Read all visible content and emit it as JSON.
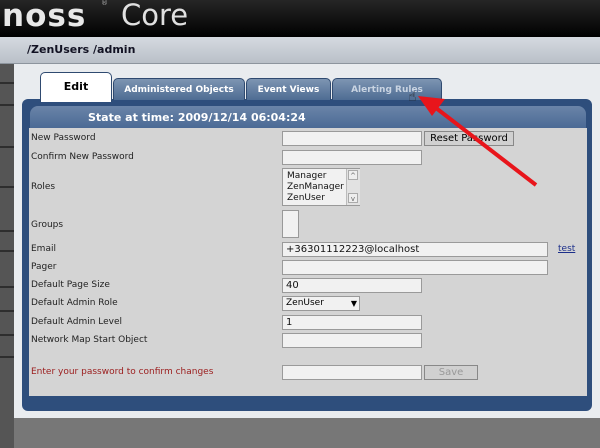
{
  "app": {
    "logo_left": "noss",
    "logo_tm": "®",
    "logo_right": "Core"
  },
  "breadcrumb": "/ZenUsers /admin",
  "tabs": [
    {
      "label": "Edit",
      "active": true
    },
    {
      "label": "Administered Objects",
      "active": false
    },
    {
      "label": "Event Views",
      "active": false
    },
    {
      "label": "Alerting Rules",
      "active": false
    }
  ],
  "state_header": "State at time: 2009/12/14 06:04:24",
  "form": {
    "new_password_label": "New Password",
    "new_password_value": "",
    "reset_password_button": "Reset Password",
    "confirm_password_label": "Confirm New Password",
    "confirm_password_value": "",
    "roles_label": "Roles",
    "roles_options": [
      "Manager",
      "ZenManager",
      "ZenUser"
    ],
    "groups_label": "Groups",
    "email_label": "Email",
    "email_value": "+36301112223@localhost",
    "test_link": "test",
    "pager_label": "Pager",
    "pager_value": "",
    "page_size_label": "Default Page Size",
    "page_size_value": "40",
    "admin_role_label": "Default Admin Role",
    "admin_role_value": "ZenUser",
    "admin_level_label": "Default Admin Level",
    "admin_level_value": "1",
    "netmap_label": "Network Map Start Object",
    "netmap_value": "",
    "confirm_prompt": "Enter your password to confirm changes",
    "confirm_value": "",
    "save_button": "Save"
  },
  "annotation": {
    "arrow_color": "#e8151b"
  }
}
